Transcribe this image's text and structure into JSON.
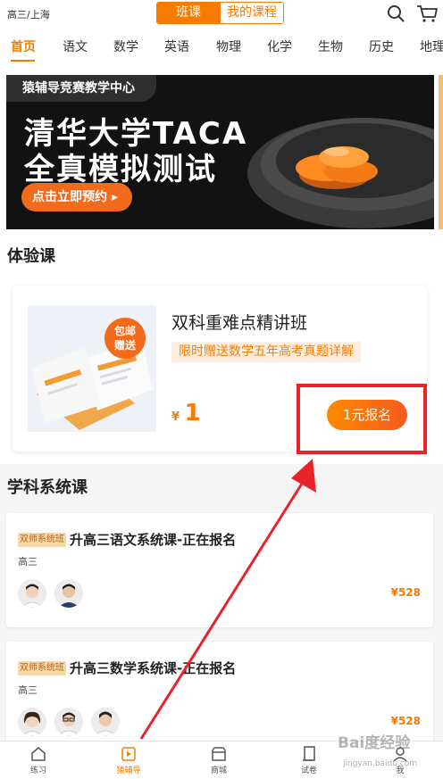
{
  "header": {
    "location": "高三/上海",
    "tab_active": "班课",
    "tab_other": "我的课程"
  },
  "subjects": [
    "首页",
    "语文",
    "数学",
    "英语",
    "物理",
    "化学",
    "生物",
    "历史",
    "地理"
  ],
  "banner": {
    "badge": "猿辅导竞赛教学中心",
    "title_line1": "清华大学TACA",
    "title_line2": "全真模拟测试",
    "cta": "点击立即预约"
  },
  "trial": {
    "section_title": "体验课",
    "course_name": "双科重难点精讲班",
    "tag": "限时赠送数学五年高考真题详解",
    "price_currency": "¥",
    "price": "1",
    "join_label": "1元报名",
    "image_sticker_line1": "包邮",
    "image_sticker_line2": "赠送"
  },
  "system": {
    "section_title": "学科系统课",
    "courses": [
      {
        "badge": "双师系统班",
        "title": "升高三语文系统课-正在报名",
        "grade": "高三",
        "price": "¥528"
      },
      {
        "badge": "双师系统班",
        "title": "升高三数学系统课-正在报名",
        "grade": "高三",
        "price": "¥528"
      }
    ]
  },
  "bottom_nav": {
    "items": [
      "练习",
      "猿辅导",
      "商城",
      "试卷",
      "我"
    ],
    "active_index": 1
  },
  "watermark": {
    "main": "Bai度经验",
    "sub": "jingyan.baidu.com"
  },
  "colors": {
    "accent": "#f57c00",
    "highlight_red": "#e8232a"
  }
}
